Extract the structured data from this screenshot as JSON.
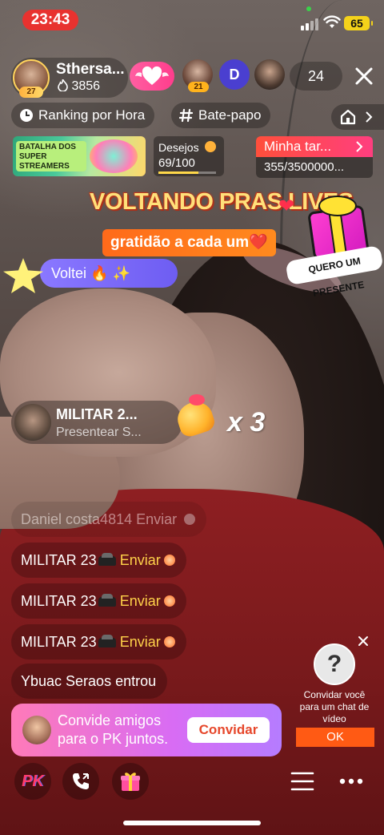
{
  "status_bar": {
    "time": "23:43",
    "battery": "65"
  },
  "host": {
    "name": "Sthersa...",
    "likes": "3856",
    "level": "27"
  },
  "viewers": [
    {
      "badge": "21",
      "initial": ""
    },
    {
      "badge": "",
      "initial": "D"
    },
    {
      "badge": "",
      "initial": ""
    }
  ],
  "viewer_count": "24",
  "chips": {
    "ranking": "Ranking por Hora",
    "chat": "Bate-papo"
  },
  "battle_banner": {
    "text": "BATALHA DOS SUPER STREAMERS"
  },
  "wishes": {
    "title": "Desejos",
    "count": "69/100",
    "progress": 0.69
  },
  "task": {
    "title": "Minha tar...",
    "progress": "355/3500000..."
  },
  "promo": {
    "title": "VOLTANDO PRAS LIVES",
    "subtitle": "gratidão a cada um❤️",
    "gift_label": "QUERO UM PRESENTE"
  },
  "voltei_message": "Voltei 🔥 ✨",
  "gift_notice": {
    "name": "MILITAR 2...",
    "action": "Presentear S...",
    "multiplier": "x 3"
  },
  "chat": [
    {
      "user": "Daniel costa4814",
      "verb": "Enviar",
      "faded": true
    },
    {
      "user": "MILITAR 23",
      "verb": "Enviar",
      "faded": false
    },
    {
      "user": "MILITAR 23",
      "verb": "Enviar",
      "faded": false
    },
    {
      "user": "MILITAR 23",
      "verb": "Enviar",
      "faded": false
    },
    {
      "user": "Ybuac Seraos",
      "verb": "entrou",
      "faded": false
    }
  ],
  "invite": {
    "text": "Convide amigos para o PK juntos.",
    "button": "Convidar"
  },
  "video_chat": {
    "text": "Convidar você para um chat de vídeo",
    "ok": "OK",
    "avatar_glyph": "?"
  },
  "bottom_bar": {
    "pk": "PK"
  },
  "colors": {
    "accent": "#ff3d8c",
    "task_head": "#ff4f3b",
    "voltei": "#7a69f6",
    "invite_button_text": "#e6472b",
    "ok_button": "#ff5a14"
  },
  "icons": [
    "fire-icon",
    "close-icon",
    "clock-icon",
    "hash-icon",
    "home-icon",
    "chevron-right-icon",
    "phone-icon",
    "gift-icon",
    "menu-icon",
    "more-icon"
  ]
}
